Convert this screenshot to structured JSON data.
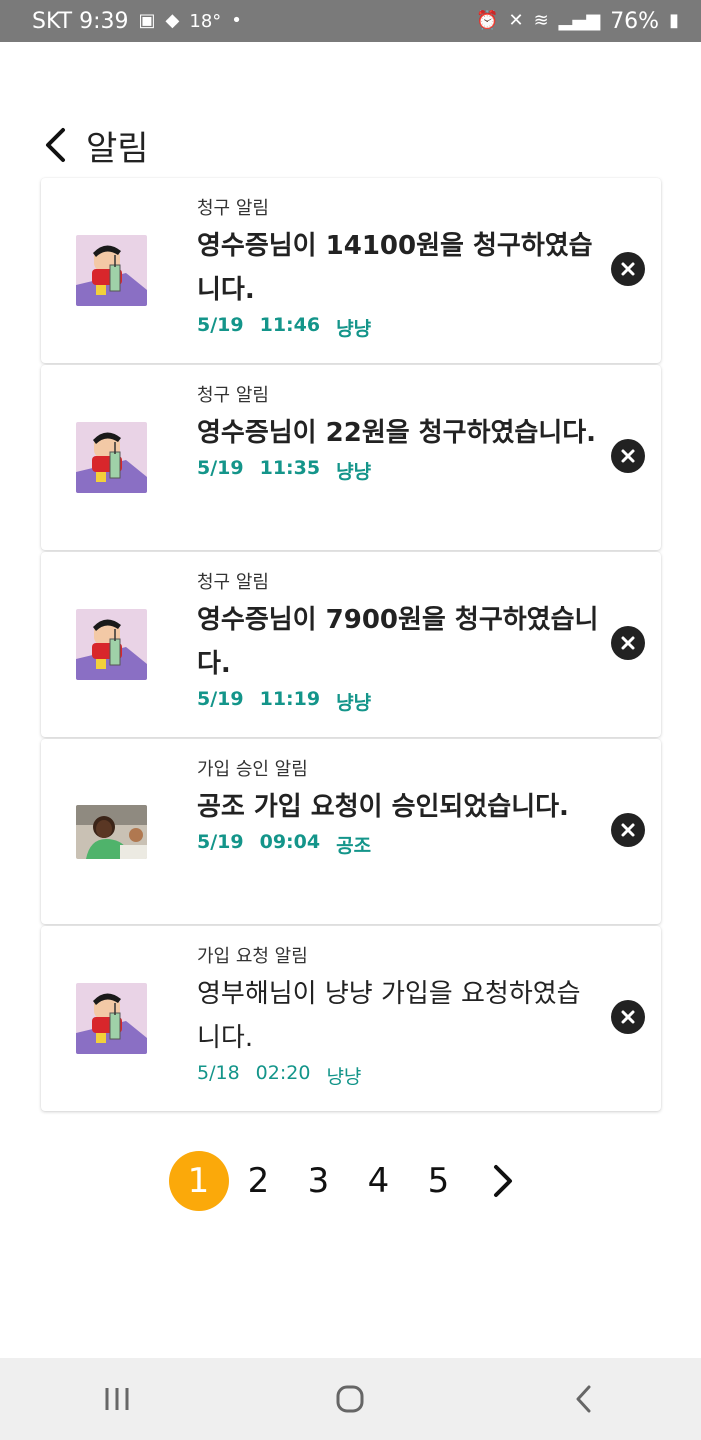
{
  "status_bar": {
    "carrier_time": "SKT 9:39",
    "temp": "18°",
    "battery": "76%"
  },
  "header": {
    "title": "알림"
  },
  "notifications": [
    {
      "type": "청구 알림",
      "message": "영수증님이 14100원을 청구하였습니다.",
      "date": "5/19",
      "time": "11:46",
      "group": "냥냥",
      "avatar": "cartoon-kid"
    },
    {
      "type": "청구 알림",
      "message": "영수증님이 22원을 청구하였습니다.",
      "date": "5/19",
      "time": "11:35",
      "group": "냥냥",
      "avatar": "cartoon-kid"
    },
    {
      "type": "청구 알림",
      "message": "영수증님이 7900원을 청구하였습니다.",
      "date": "5/19",
      "time": "11:19",
      "group": "냥냥",
      "avatar": "cartoon-kid"
    },
    {
      "type": "가입 승인 알림",
      "message": "공조 가입 요청이 승인되었습니다.",
      "date": "5/19",
      "time": "09:04",
      "group": "공조",
      "avatar": "photo-boy"
    },
    {
      "type": "가입 요청 알림",
      "message": "영부해님이 냥냥 가입을 요청하였습니다.",
      "date": "5/18",
      "time": "02:20",
      "group": "냥냥",
      "avatar": "cartoon-kid"
    }
  ],
  "pagination": {
    "pages": [
      "1",
      "2",
      "3",
      "4",
      "5"
    ],
    "active": "1"
  },
  "colors": {
    "accent": "#14958a",
    "active_page": "#fba90a",
    "status_bar": "#7a7a7a"
  }
}
